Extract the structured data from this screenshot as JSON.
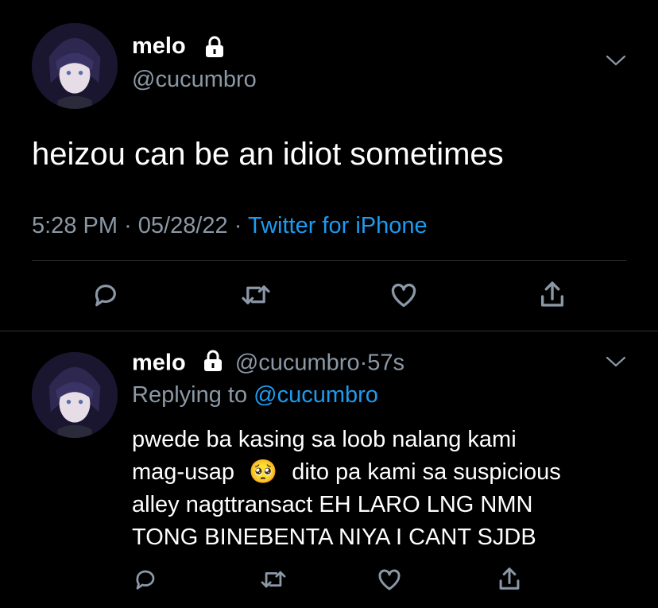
{
  "main_tweet": {
    "display_name": "melo",
    "handle": "@cucumbro",
    "text": "heizou can be an idiot sometimes",
    "time": "5:28 PM",
    "separator": "·",
    "date": "05/28/22",
    "source": "Twitter for iPhone",
    "icons": {
      "lock": "lock-icon",
      "chevron": "chevron-down-icon"
    },
    "actions": [
      "reply-icon",
      "retweet-icon",
      "like-icon",
      "share-icon"
    ]
  },
  "reply_tweet": {
    "display_name": "melo",
    "handle": "@cucumbro",
    "separator": "·",
    "age": "57s",
    "replying_label": "Replying to",
    "replying_to": "@cucumbro",
    "text_line1": "pwede ba kasing sa loob nalang kami",
    "text_line2a": "mag-usap",
    "emoji": "🥺",
    "text_line2b": "dito pa kami sa suspicious",
    "text_line3": "alley nagttransact EH LARO LNG NMN",
    "text_line4": "TONG BINEBENTA NIYA I CANT SJDB",
    "actions": [
      "reply-icon",
      "retweet-icon",
      "like-icon",
      "share-icon"
    ]
  },
  "colors": {
    "background": "#000000",
    "text": "#ffffff",
    "muted": "#8b98a5",
    "link": "#1d9bf0",
    "divider": "#2f3336"
  }
}
